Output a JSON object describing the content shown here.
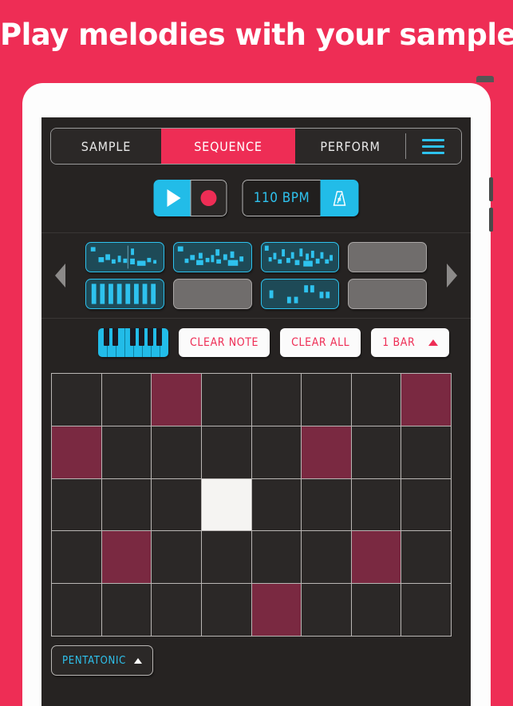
{
  "headline": "Play melodies with your samples",
  "colors": {
    "background_pink": "#EE2D55",
    "accent_cyan": "#22BCE8",
    "screen_dark": "#262322",
    "cell_on": "#7A2941",
    "cell_off": "#2B2827",
    "cell_active": "#F5F4F2",
    "pad_empty_gray": "#706D6C",
    "pad_filled_teal": "#1E4A57"
  },
  "tabs": [
    {
      "label": "SAMPLE",
      "active": false
    },
    {
      "label": "SEQUENCE",
      "active": true
    },
    {
      "label": "PERFORM",
      "active": false
    }
  ],
  "menu_icon": "hamburger-menu-icon",
  "transport": {
    "play_icon": "play-icon",
    "record_icon": "record-icon",
    "bpm_value": "110 BPM",
    "metronome_icon": "metronome-icon"
  },
  "pads": {
    "prev_icon": "chevron-left-icon",
    "next_icon": "chevron-right-icon",
    "items": [
      {
        "index": 1,
        "state": "filled",
        "pattern": "waveform-sparse"
      },
      {
        "index": 2,
        "state": "filled",
        "pattern": "waveform-medium"
      },
      {
        "index": 3,
        "state": "filled",
        "pattern": "waveform-dense"
      },
      {
        "index": 4,
        "state": "empty",
        "pattern": ""
      },
      {
        "index": 5,
        "state": "filled",
        "pattern": "bars"
      },
      {
        "index": 6,
        "state": "empty",
        "pattern": ""
      },
      {
        "index": 7,
        "state": "filled",
        "pattern": "waveform-blocks"
      },
      {
        "index": 8,
        "state": "empty",
        "pattern": ""
      }
    ]
  },
  "tools": {
    "piano_icon": "piano-keyboard-icon",
    "clear_note_label": "CLEAR NOTE",
    "clear_all_label": "CLEAR ALL",
    "bars_label": "1 BAR",
    "bars_caret_icon": "caret-up-icon"
  },
  "sequencer": {
    "columns": 8,
    "rows": 5,
    "cells": [
      [
        "off",
        "off",
        "on",
        "off",
        "off",
        "off",
        "off",
        "on"
      ],
      [
        "on",
        "off",
        "off",
        "off",
        "off",
        "on",
        "off",
        "off"
      ],
      [
        "off",
        "off",
        "off",
        "active",
        "off",
        "off",
        "off",
        "off"
      ],
      [
        "off",
        "on",
        "off",
        "off",
        "off",
        "off",
        "on",
        "off"
      ],
      [
        "off",
        "off",
        "off",
        "off",
        "on",
        "off",
        "off",
        "off"
      ]
    ]
  },
  "scale": {
    "label": "PENTATONIC",
    "caret_icon": "caret-up-icon"
  }
}
